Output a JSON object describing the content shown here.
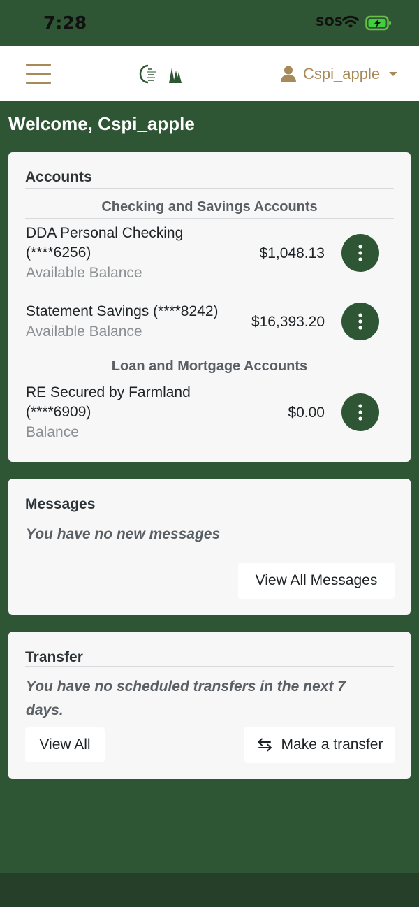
{
  "status_bar": {
    "time": "7:28",
    "sos": "SOS"
  },
  "header": {
    "user_name": "Cspi_apple"
  },
  "welcome": "Welcome, Cspi_apple",
  "accounts": {
    "title": "Accounts",
    "sections": [
      {
        "heading": "Checking and Savings Accounts",
        "items": [
          {
            "name_line1": "DDA Personal Checking",
            "name_line2": "(****6256)",
            "sub": "Available Balance",
            "amount": "$1,048.13"
          },
          {
            "name_line1": "Statement Savings (****8242)",
            "name_line2": "",
            "sub": "Available Balance",
            "amount": "$16,393.20"
          }
        ]
      },
      {
        "heading": "Loan and Mortgage Accounts",
        "items": [
          {
            "name_line1": "RE Secured by Farmland",
            "name_line2": "(****6909)",
            "sub": "Balance",
            "amount": "$0.00"
          }
        ]
      }
    ]
  },
  "messages": {
    "title": "Messages",
    "empty_text": "You have no new messages",
    "view_all_label": "View All Messages"
  },
  "transfer": {
    "title": "Transfer",
    "empty_line1": "You have no scheduled transfers in the next 7",
    "empty_line2": "days.",
    "view_all_label": "View All",
    "make_transfer_label": "Make a transfer"
  },
  "colors": {
    "brand_green": "#2f5634",
    "accent_gold": "#a88a5a",
    "card_bg": "#f7f7f8"
  },
  "icons": [
    "menu-icon",
    "bank-logo",
    "user-icon",
    "chevron-down-icon",
    "more-vertical-icon",
    "transfer-arrows-icon",
    "wifi-icon",
    "battery-icon"
  ]
}
